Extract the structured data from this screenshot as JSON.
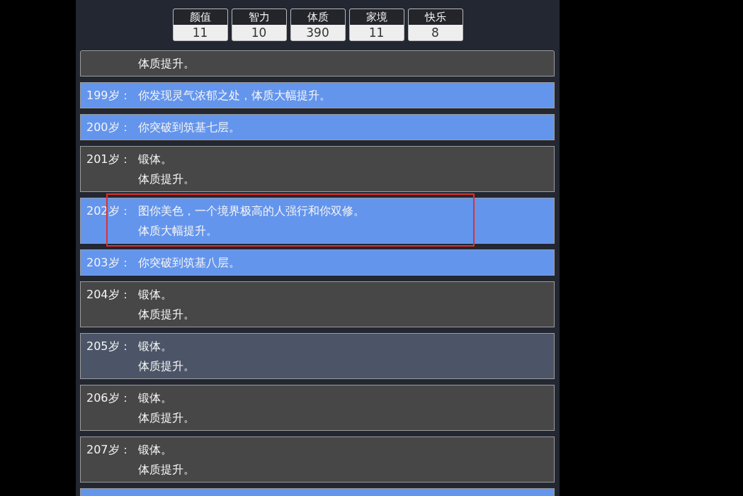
{
  "stats": [
    {
      "label": "颜值",
      "value": "11"
    },
    {
      "label": "智力",
      "value": "10"
    },
    {
      "label": "体质",
      "value": "390"
    },
    {
      "label": "家境",
      "value": "11"
    },
    {
      "label": "快乐",
      "value": "8"
    }
  ],
  "events": [
    {
      "color": "#474747",
      "lines": [
        "体质提升。"
      ],
      "circled": false
    },
    {
      "age": "199岁：",
      "color": "#6495ed",
      "lines": [
        "你发现灵气浓郁之处，体质大幅提升。"
      ],
      "circled": false
    },
    {
      "age": "200岁：",
      "color": "#6495ed",
      "lines": [
        "你突破到筑基七层。"
      ],
      "circled": false
    },
    {
      "age": "201岁：",
      "color": "#474747",
      "lines": [
        "锻体。",
        "体质提升。"
      ],
      "circled": false
    },
    {
      "age": "202岁：",
      "color": "#6495ed",
      "lines": [
        "图你美色，一个境界极高的人强行和你双修。",
        "体质大幅提升。"
      ],
      "circled": true
    },
    {
      "age": "203岁：",
      "color": "#6495ed",
      "lines": [
        "你突破到筑基八层。"
      ],
      "circled": false
    },
    {
      "age": "204岁：",
      "color": "#474747",
      "lines": [
        "锻体。",
        "体质提升。"
      ],
      "circled": false
    },
    {
      "age": "205岁：",
      "color": "#4b5567",
      "lines": [
        "锻体。",
        "体质提升。"
      ],
      "circled": false
    },
    {
      "age": "206岁：",
      "color": "#474747",
      "lines": [
        "锻体。",
        "体质提升。"
      ],
      "circled": false
    },
    {
      "age": "207岁：",
      "color": "#474747",
      "lines": [
        "锻体。",
        "体质提升。"
      ],
      "circled": false
    },
    {
      "color": "#6495ed",
      "circled": false
    }
  ]
}
